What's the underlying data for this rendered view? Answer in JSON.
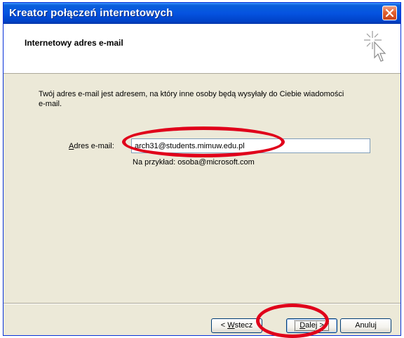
{
  "window": {
    "title": "Kreator połączeń internetowych"
  },
  "header": {
    "title": "Internetowy adres e-mail",
    "icon": "wizard-sparkle-cursor-icon"
  },
  "content": {
    "description": "Twój adres e-mail jest adresem, na który inne osoby będą wysyłały do Ciebie wiadomości e-mail.",
    "email_label_accel": "A",
    "email_label_rest": "dres e-mail:",
    "email_value": "arch31@students.mimuw.edu.pl",
    "example_text": "Na przykład: osoba@microsoft.com"
  },
  "buttons": {
    "back_accel": "W",
    "back_prefix": "< ",
    "back_rest": "stecz",
    "next_accel": "D",
    "next_rest": "alej >",
    "cancel": "Anuluj"
  },
  "colors": {
    "title_bar": "#0553e0",
    "annotation": "#e0001a",
    "window_body": "#ece9d8"
  }
}
